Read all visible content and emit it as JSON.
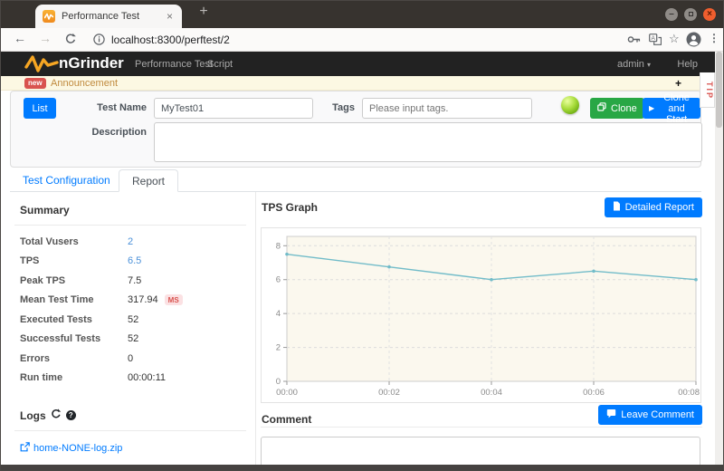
{
  "browser": {
    "tab_title": "Performance Test",
    "url": "localhost:8300/perftest/2"
  },
  "icons": {
    "new_tab": "+",
    "tab_close": "×",
    "back": "←",
    "forward": "→",
    "star": "☆",
    "kebab": "⋮",
    "minimize": "–",
    "close_window": "×",
    "announce_expand": "+",
    "admin_caret": "▾",
    "play": "▶"
  },
  "navbar": {
    "brand": "nGrinder",
    "items": [
      {
        "label": "Performance Test"
      },
      {
        "label": "Script"
      }
    ],
    "user_menu": "admin",
    "help": "Help"
  },
  "announcement": {
    "badge": "new",
    "label": "Announcement",
    "tip_label": "TIP"
  },
  "form": {
    "list_button": "List",
    "test_name_label": "Test Name",
    "test_name_value": "MyTest01",
    "tags_label": "Tags",
    "tags_placeholder": "Please input tags.",
    "clone_button": "Clone",
    "clone_start_button": "Clone and Start",
    "description_label": "Description",
    "description_value": ""
  },
  "tabs": [
    {
      "label": "Test Configuration",
      "active": false
    },
    {
      "label": "Report",
      "active": true
    }
  ],
  "summary": {
    "title": "Summary",
    "rows": [
      {
        "label": "Total Vusers",
        "value": "2"
      },
      {
        "label": "TPS",
        "value": "6.5"
      },
      {
        "label": "Peak TPS",
        "value": "7.5"
      },
      {
        "label": "Mean Test Time",
        "value": "317.94",
        "badge": "MS"
      },
      {
        "label": "Executed Tests",
        "value": "52"
      },
      {
        "label": "Successful Tests",
        "value": "52"
      },
      {
        "label": "Errors",
        "value": "0"
      },
      {
        "label": "Run time",
        "value": "00:00:11"
      }
    ]
  },
  "logs": {
    "title": "Logs",
    "file": "home-NONE-log.zip"
  },
  "report": {
    "tps_graph_title": "TPS Graph",
    "detailed_report_button": "Detailed Report",
    "comment_title": "Comment",
    "leave_comment_button": "Leave Comment"
  },
  "chart_data": {
    "type": "line",
    "title": "TPS Graph",
    "x": [
      "00:00",
      "00:02",
      "00:04",
      "00:06",
      "00:08"
    ],
    "series": [
      {
        "name": "TPS",
        "values": [
          7.5,
          6.75,
          6.0,
          6.5,
          6.0
        ]
      }
    ],
    "xlabel": "",
    "ylabel": "",
    "ylim": [
      0,
      8
    ],
    "yticks": [
      0,
      2,
      4,
      6,
      8
    ],
    "grid": true,
    "legend": "none",
    "line_color": "#72bcc9",
    "plot_bg": "#fbf8ee"
  },
  "colors": {
    "accent_blue": "#007bff",
    "accent_green": "#28a745",
    "navbar_bg": "#222222",
    "announce_bg": "#fcf8e3",
    "badge_red": "#d9534f"
  }
}
